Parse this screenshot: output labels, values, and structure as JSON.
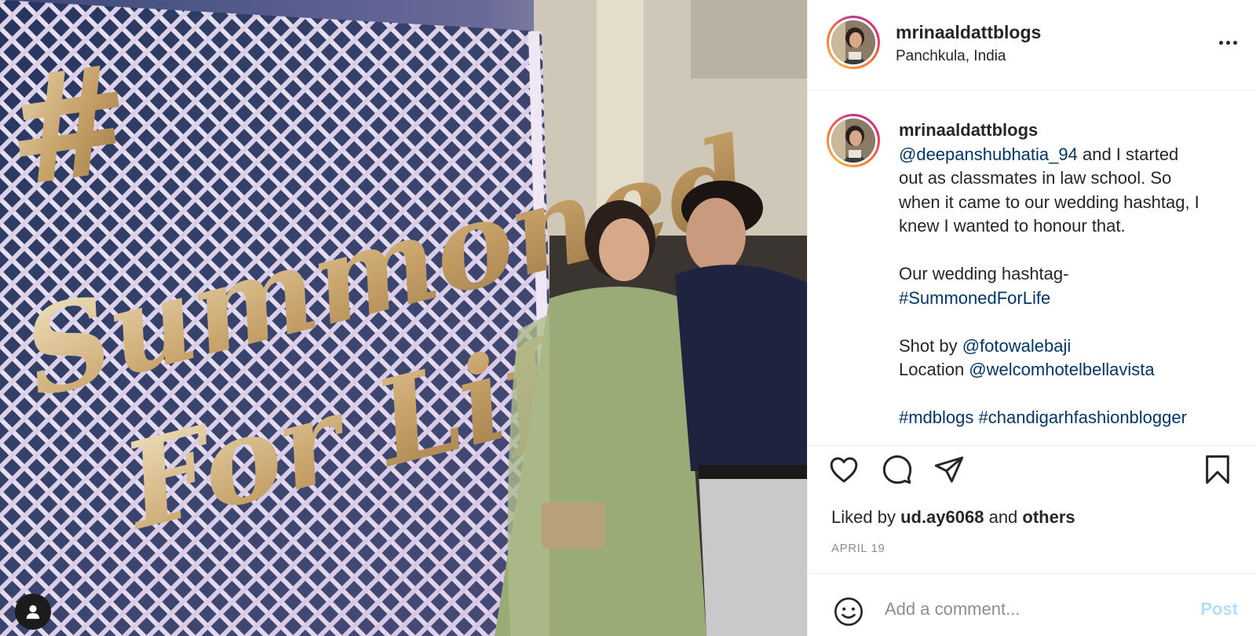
{
  "post": {
    "username": "mrinaaldattblogs",
    "location": "Panchkula, India",
    "more_icon": "more-horizontal-icon"
  },
  "photo": {
    "sign_hashtag": "#",
    "sign_word1": "Summoned",
    "sign_word2": "For Life",
    "user_tag_icon": "user-icon"
  },
  "caption": {
    "username": "mrinaaldattblogs",
    "mention1": "@deepanshubhatia_94",
    "line1_rest": " and I started",
    "line2": "out as classmates in law school. So",
    "line3": "when it came to our wedding hashtag, I",
    "line4": "knew I wanted to honour that.",
    "line5": "Our wedding hashtag-",
    "hashtag_main": "#SummonedForLife",
    "shot_by_label": "Shot by ",
    "shot_by_handle": "@fotowalebaji",
    "location_label": "Location ",
    "location_handle": "@welcomhotelbellavista",
    "tag1": "#mdblogs",
    "tag2": "#chandigarhfashionblogger"
  },
  "actions": {
    "like_icon": "heart-icon",
    "comment_icon": "comment-icon",
    "share_icon": "send-icon",
    "save_icon": "bookmark-icon"
  },
  "likes": {
    "prefix": "Liked by ",
    "user": "ud.ay6068",
    "middle": " and ",
    "others": "others"
  },
  "date": "APRIL 19",
  "comment": {
    "placeholder": "Add a comment...",
    "post_label": "Post",
    "emoji_icon": "emoji-icon"
  },
  "colors": {
    "link": "#00376b",
    "muted": "#8e8e8e",
    "post_disabled": "#b2dffc"
  }
}
